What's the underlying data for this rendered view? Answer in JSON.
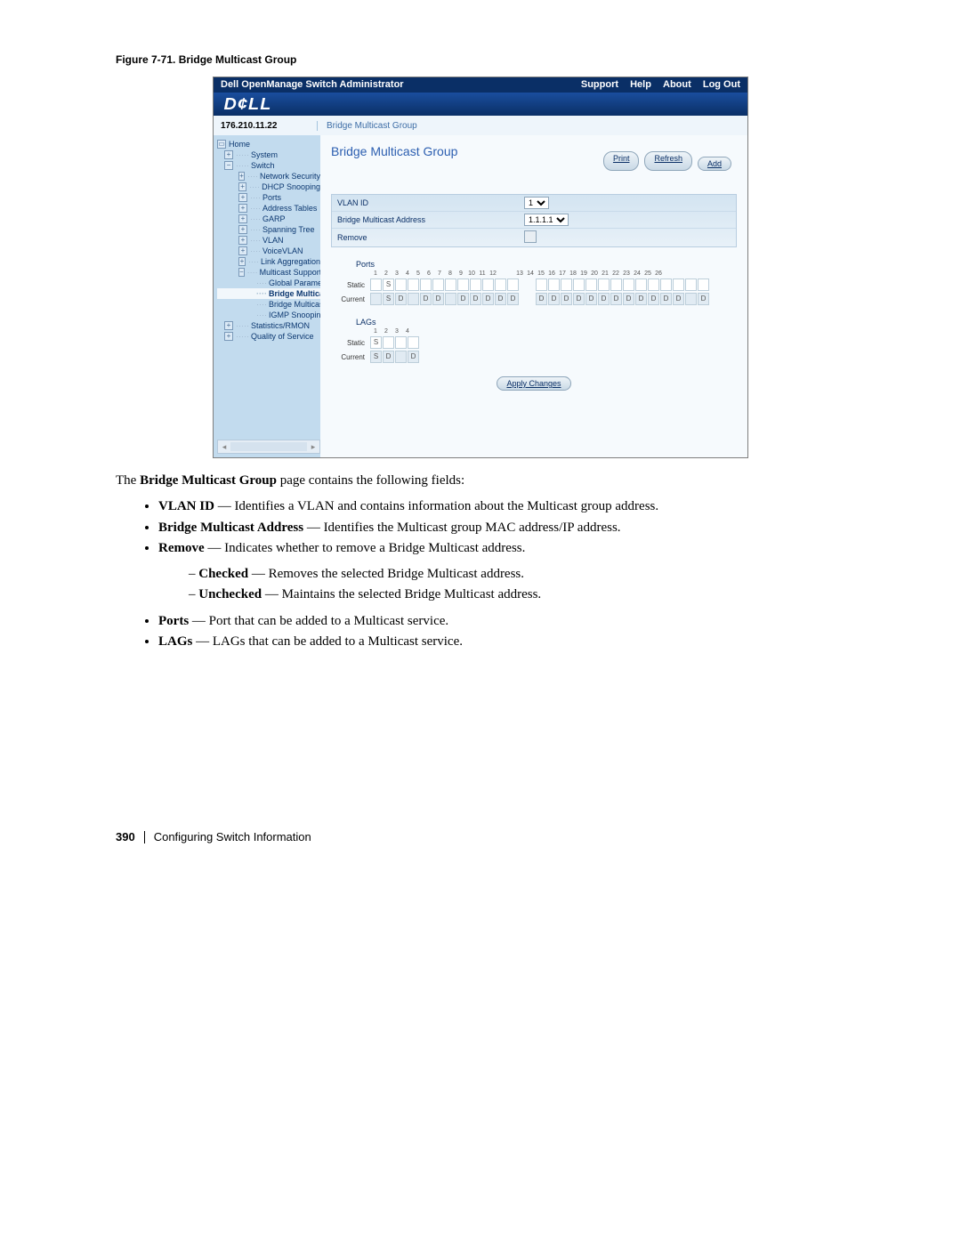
{
  "figure_caption": "Figure 7-71.    Bridge Multicast Group",
  "topbar": {
    "title": "Dell OpenManage Switch Administrator",
    "links": {
      "support": "Support",
      "help": "Help",
      "about": "About",
      "logout": "Log Out"
    }
  },
  "logo_text": "D¢LL",
  "ip": "176.210.11.22",
  "breadcrumb": "Bridge Multicast Group",
  "nav": {
    "home": "Home",
    "system": "System",
    "switch": "Switch",
    "items": [
      "Network Security",
      "DHCP Snooping",
      "Ports",
      "Address Tables",
      "GARP",
      "Spanning Tree",
      "VLAN",
      "VoiceVLAN",
      "Link Aggregation",
      "Multicast Support"
    ],
    "sub": {
      "global": "Global Parameters",
      "bm": "Bridge Multicast",
      "bmf": "Bridge Multicast F",
      "igmp": "IGMP Snooping"
    },
    "stats": "Statistics/RMON",
    "qos": "Quality of Service"
  },
  "content": {
    "title": "Bridge Multicast Group",
    "buttons": {
      "print": "Print",
      "refresh": "Refresh",
      "add": "Add"
    },
    "form": {
      "vlan_label": "VLAN ID",
      "vlan_value": "1",
      "bma_label": "Bridge Multicast Address",
      "bma_value": "1.1.1.1",
      "remove_label": "Remove"
    },
    "ports": {
      "heading": "Ports",
      "nums_a": [
        "1",
        "2",
        "3",
        "4",
        "5",
        "6",
        "7",
        "8",
        "9",
        "10",
        "11",
        "12"
      ],
      "nums_b": [
        "13",
        "14",
        "15",
        "16",
        "17",
        "18",
        "19",
        "20",
        "21",
        "22",
        "23",
        "24",
        "25",
        "26"
      ],
      "static_label": "Static",
      "current_label": "Current",
      "static_vals_a": [
        "",
        "S",
        "",
        "",
        "",
        "",
        "",
        "",
        "",
        "",
        "",
        ""
      ],
      "current_vals_a": [
        "",
        "S",
        "D",
        "",
        "D",
        "D",
        "",
        "D",
        "D",
        "D",
        "D",
        "D"
      ],
      "current_vals_b": [
        "D",
        "D",
        "D",
        "D",
        "D",
        "D",
        "D",
        "D",
        "D",
        "D",
        "D",
        "D",
        "",
        "D"
      ]
    },
    "lags": {
      "heading": "LAGs",
      "nums": [
        "1",
        "2",
        "3",
        "4"
      ],
      "static_label": "Static",
      "current_label": "Current",
      "static_vals": [
        "S",
        "",
        "",
        ""
      ],
      "current_vals": [
        "S",
        "D",
        "",
        "D"
      ]
    },
    "apply": "Apply Changes"
  },
  "doc": {
    "intro_pre": "The ",
    "intro_bold": "Bridge Multicast Group",
    "intro_post": " page contains the following fields:",
    "b1_b": "VLAN ID",
    "b1_t": " — Identifies a VLAN and contains information about the Multicast group address.",
    "b2_b": "Bridge Multicast Address",
    "b2_t": " — Identifies the Multicast group MAC address/IP address.",
    "b3_b": "Remove",
    "b3_t": " — Indicates whether to remove a Bridge Multicast address.",
    "b3a_b": "Checked",
    "b3a_t": " — Removes the selected Bridge Multicast address.",
    "b3b_b": "Unchecked",
    "b3b_t": " — Maintains the selected Bridge Multicast address.",
    "b4_b": "Ports",
    "b4_t": " — Port that can be added to a Multicast service.",
    "b5_b": "LAGs",
    "b5_t": " — LAGs that can be added to a Multicast service."
  },
  "footer": {
    "page": "390",
    "section": "Configuring Switch Information"
  }
}
